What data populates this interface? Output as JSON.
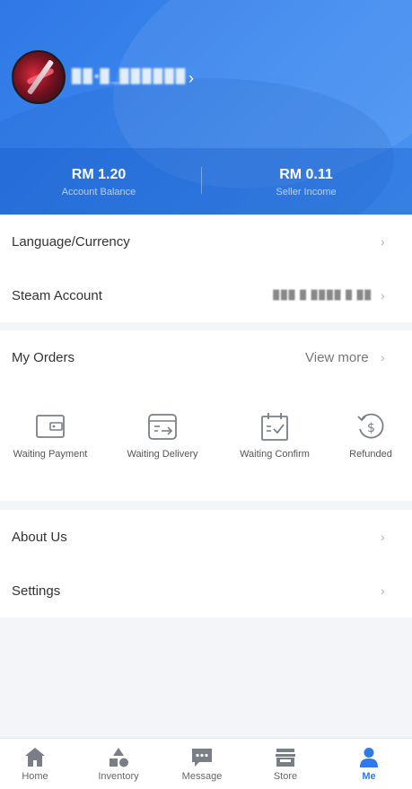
{
  "profile": {
    "username": "▉▉•▉_▉▉▉▉▉▉",
    "chevron": "›"
  },
  "balances": {
    "account_balance_value": "RM 1.20",
    "account_balance_label": "Account Balance",
    "seller_income_value": "RM 0.11",
    "seller_income_label": "Seller Income"
  },
  "settings_rows": {
    "language_currency": "Language/Currency",
    "steam_account": "Steam Account",
    "steam_account_value": "▉▉▉ ▉ ▉▉▉▉ ▉ ▉▉"
  },
  "orders": {
    "title": "My Orders",
    "view_more": "View more",
    "items": [
      {
        "label": "Waiting Payment",
        "icon": "wallet-icon"
      },
      {
        "label": "Waiting Delivery",
        "icon": "delivery-icon"
      },
      {
        "label": "Waiting Confirm",
        "icon": "calendar-check-icon"
      },
      {
        "label": "Refunded",
        "icon": "refund-icon"
      }
    ]
  },
  "more_rows": {
    "about_us": "About Us",
    "settings": "Settings"
  },
  "chevron": "›",
  "nav": {
    "items": [
      {
        "label": "Home",
        "icon": "home-icon"
      },
      {
        "label": "Inventory",
        "icon": "inventory-icon"
      },
      {
        "label": "Message",
        "icon": "message-icon"
      },
      {
        "label": "Store",
        "icon": "store-icon"
      },
      {
        "label": "Me",
        "icon": "person-icon",
        "active": true
      }
    ]
  },
  "colors": {
    "header_blue": "#3b87ee",
    "active_nav": "#2d7be8",
    "inactive_icon": "#7a7f87"
  }
}
